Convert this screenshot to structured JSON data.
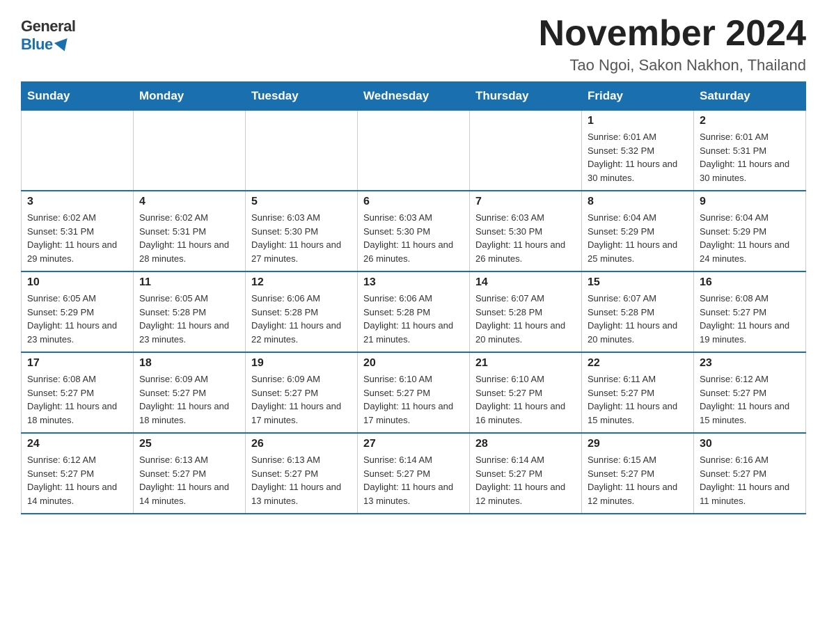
{
  "header": {
    "logo_general": "General",
    "logo_blue": "Blue",
    "title": "November 2024",
    "subtitle": "Tao Ngoi, Sakon Nakhon, Thailand"
  },
  "calendar": {
    "days_of_week": [
      "Sunday",
      "Monday",
      "Tuesday",
      "Wednesday",
      "Thursday",
      "Friday",
      "Saturday"
    ],
    "weeks": [
      [
        {
          "day": "",
          "info": ""
        },
        {
          "day": "",
          "info": ""
        },
        {
          "day": "",
          "info": ""
        },
        {
          "day": "",
          "info": ""
        },
        {
          "day": "",
          "info": ""
        },
        {
          "day": "1",
          "info": "Sunrise: 6:01 AM\nSunset: 5:32 PM\nDaylight: 11 hours\nand 30 minutes."
        },
        {
          "day": "2",
          "info": "Sunrise: 6:01 AM\nSunset: 5:31 PM\nDaylight: 11 hours\nand 30 minutes."
        }
      ],
      [
        {
          "day": "3",
          "info": "Sunrise: 6:02 AM\nSunset: 5:31 PM\nDaylight: 11 hours\nand 29 minutes."
        },
        {
          "day": "4",
          "info": "Sunrise: 6:02 AM\nSunset: 5:31 PM\nDaylight: 11 hours\nand 28 minutes."
        },
        {
          "day": "5",
          "info": "Sunrise: 6:03 AM\nSunset: 5:30 PM\nDaylight: 11 hours\nand 27 minutes."
        },
        {
          "day": "6",
          "info": "Sunrise: 6:03 AM\nSunset: 5:30 PM\nDaylight: 11 hours\nand 26 minutes."
        },
        {
          "day": "7",
          "info": "Sunrise: 6:03 AM\nSunset: 5:30 PM\nDaylight: 11 hours\nand 26 minutes."
        },
        {
          "day": "8",
          "info": "Sunrise: 6:04 AM\nSunset: 5:29 PM\nDaylight: 11 hours\nand 25 minutes."
        },
        {
          "day": "9",
          "info": "Sunrise: 6:04 AM\nSunset: 5:29 PM\nDaylight: 11 hours\nand 24 minutes."
        }
      ],
      [
        {
          "day": "10",
          "info": "Sunrise: 6:05 AM\nSunset: 5:29 PM\nDaylight: 11 hours\nand 23 minutes."
        },
        {
          "day": "11",
          "info": "Sunrise: 6:05 AM\nSunset: 5:28 PM\nDaylight: 11 hours\nand 23 minutes."
        },
        {
          "day": "12",
          "info": "Sunrise: 6:06 AM\nSunset: 5:28 PM\nDaylight: 11 hours\nand 22 minutes."
        },
        {
          "day": "13",
          "info": "Sunrise: 6:06 AM\nSunset: 5:28 PM\nDaylight: 11 hours\nand 21 minutes."
        },
        {
          "day": "14",
          "info": "Sunrise: 6:07 AM\nSunset: 5:28 PM\nDaylight: 11 hours\nand 20 minutes."
        },
        {
          "day": "15",
          "info": "Sunrise: 6:07 AM\nSunset: 5:28 PM\nDaylight: 11 hours\nand 20 minutes."
        },
        {
          "day": "16",
          "info": "Sunrise: 6:08 AM\nSunset: 5:27 PM\nDaylight: 11 hours\nand 19 minutes."
        }
      ],
      [
        {
          "day": "17",
          "info": "Sunrise: 6:08 AM\nSunset: 5:27 PM\nDaylight: 11 hours\nand 18 minutes."
        },
        {
          "day": "18",
          "info": "Sunrise: 6:09 AM\nSunset: 5:27 PM\nDaylight: 11 hours\nand 18 minutes."
        },
        {
          "day": "19",
          "info": "Sunrise: 6:09 AM\nSunset: 5:27 PM\nDaylight: 11 hours\nand 17 minutes."
        },
        {
          "day": "20",
          "info": "Sunrise: 6:10 AM\nSunset: 5:27 PM\nDaylight: 11 hours\nand 17 minutes."
        },
        {
          "day": "21",
          "info": "Sunrise: 6:10 AM\nSunset: 5:27 PM\nDaylight: 11 hours\nand 16 minutes."
        },
        {
          "day": "22",
          "info": "Sunrise: 6:11 AM\nSunset: 5:27 PM\nDaylight: 11 hours\nand 15 minutes."
        },
        {
          "day": "23",
          "info": "Sunrise: 6:12 AM\nSunset: 5:27 PM\nDaylight: 11 hours\nand 15 minutes."
        }
      ],
      [
        {
          "day": "24",
          "info": "Sunrise: 6:12 AM\nSunset: 5:27 PM\nDaylight: 11 hours\nand 14 minutes."
        },
        {
          "day": "25",
          "info": "Sunrise: 6:13 AM\nSunset: 5:27 PM\nDaylight: 11 hours\nand 14 minutes."
        },
        {
          "day": "26",
          "info": "Sunrise: 6:13 AM\nSunset: 5:27 PM\nDaylight: 11 hours\nand 13 minutes."
        },
        {
          "day": "27",
          "info": "Sunrise: 6:14 AM\nSunset: 5:27 PM\nDaylight: 11 hours\nand 13 minutes."
        },
        {
          "day": "28",
          "info": "Sunrise: 6:14 AM\nSunset: 5:27 PM\nDaylight: 11 hours\nand 12 minutes."
        },
        {
          "day": "29",
          "info": "Sunrise: 6:15 AM\nSunset: 5:27 PM\nDaylight: 11 hours\nand 12 minutes."
        },
        {
          "day": "30",
          "info": "Sunrise: 6:16 AM\nSunset: 5:27 PM\nDaylight: 11 hours\nand 11 minutes."
        }
      ]
    ]
  }
}
